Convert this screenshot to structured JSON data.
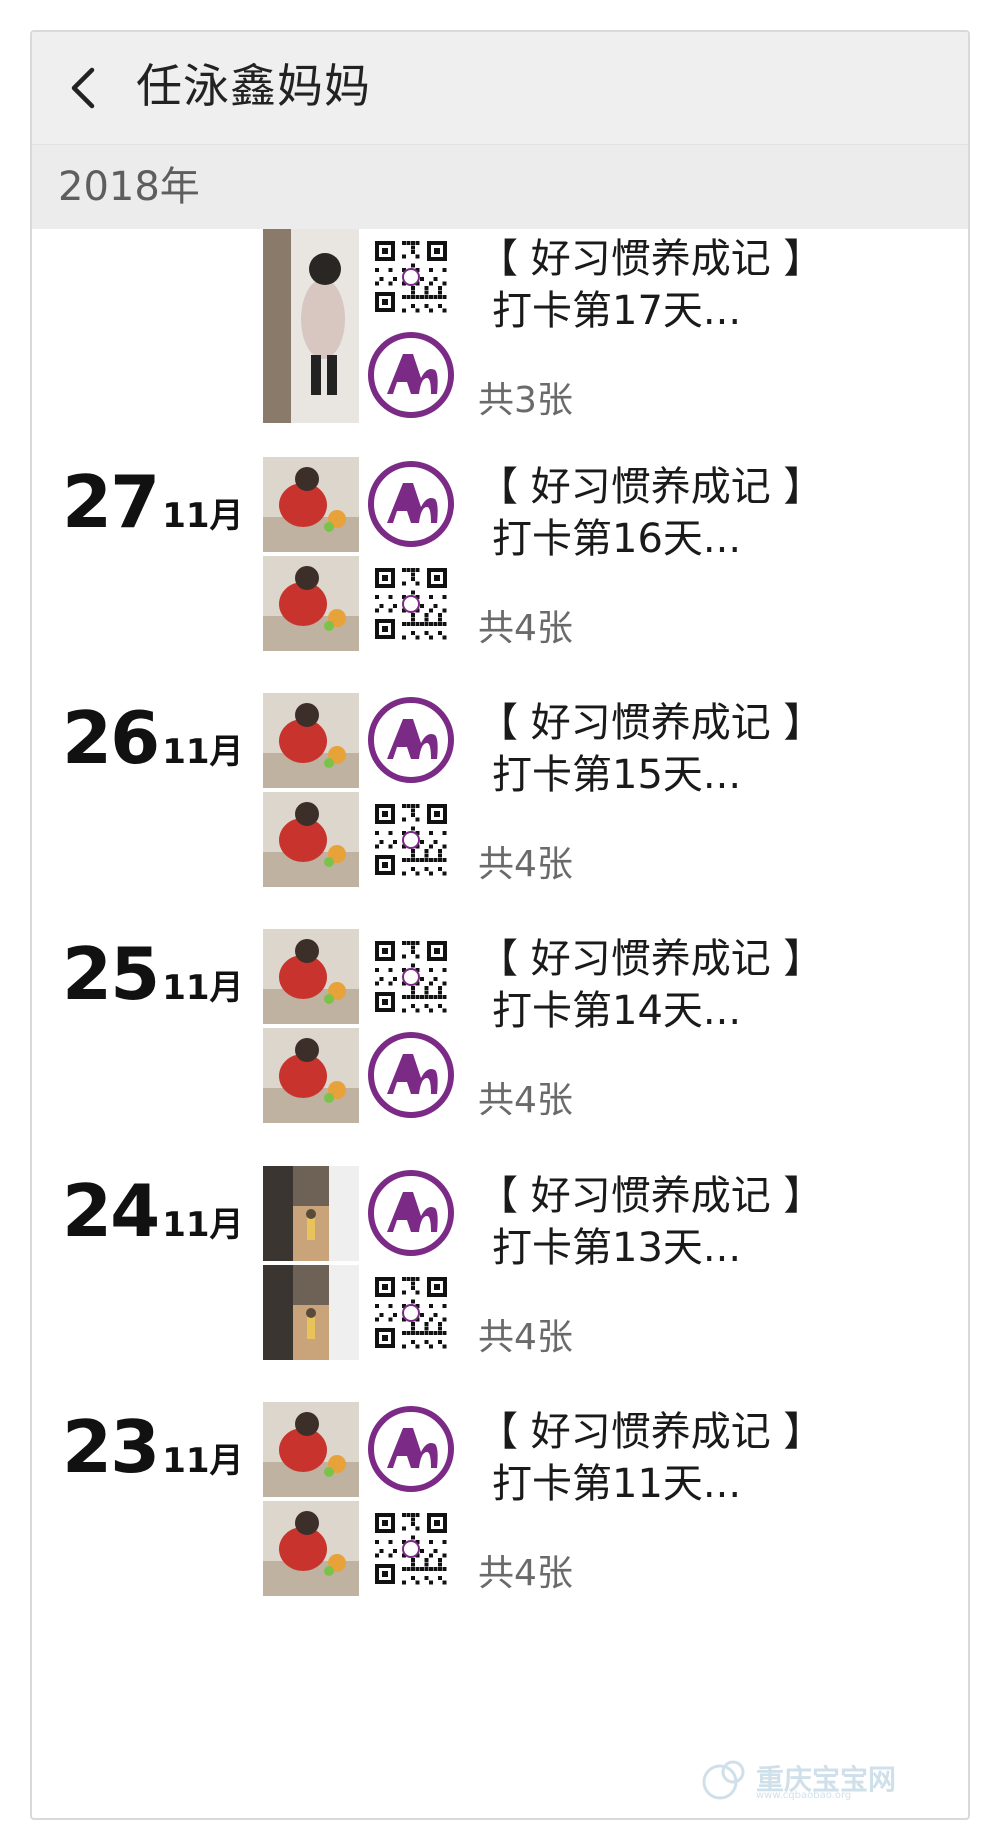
{
  "header": {
    "back_icon": "chevron-left-icon",
    "title": "任泳鑫妈妈"
  },
  "year_label": "2018年",
  "posts": [
    {
      "day": "",
      "month": "",
      "caption_line1": "【 好习惯养成记 】",
      "caption_line2": "打卡第17天...",
      "count": "共3张",
      "images": [
        "child-photo",
        "qr-code",
        "",
        "logo"
      ]
    },
    {
      "day": "27",
      "month": "11月",
      "caption_line1": "【 好习惯养成记 】",
      "caption_line2": "打卡第16天...",
      "count": "共4张",
      "images": [
        "child-photo",
        "logo",
        "child-photo",
        "qr-code"
      ]
    },
    {
      "day": "26",
      "month": "11月",
      "caption_line1": "【 好习惯养成记 】",
      "caption_line2": "打卡第15天...",
      "count": "共4张",
      "images": [
        "child-photo",
        "logo",
        "child-photo",
        "qr-code"
      ]
    },
    {
      "day": "25",
      "month": "11月",
      "caption_line1": "【 好习惯养成记 】",
      "caption_line2": "打卡第14天...",
      "count": "共4张",
      "images": [
        "child-photo",
        "qr-code",
        "child-photo",
        "logo"
      ]
    },
    {
      "day": "24",
      "month": "11月",
      "caption_line1": "【 好习惯养成记 】",
      "caption_line2": "打卡第13天...",
      "count": "共4张",
      "images": [
        "hallway-photo",
        "logo",
        "hallway-photo",
        "qr-code"
      ]
    },
    {
      "day": "23",
      "month": "11月",
      "caption_line1": "【 好习惯养成记 】",
      "caption_line2": "打卡第11天...",
      "count": "共4张",
      "images": [
        "child-photo",
        "logo",
        "child-photo",
        "qr-code"
      ]
    }
  ],
  "watermark": {
    "text": "重庆宝宝网",
    "sub": "www.cqbaobao.org"
  },
  "colors": {
    "logo_purple": "#7b2a86",
    "header_bg": "#efefef",
    "year_bg": "#ececec",
    "count_gray": "#6a6a6a"
  }
}
